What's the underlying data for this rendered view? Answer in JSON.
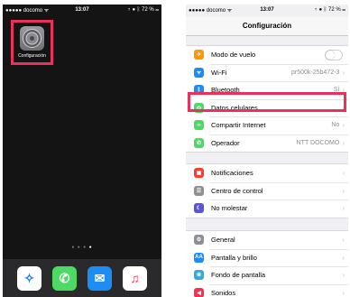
{
  "home": {
    "status": {
      "carrier": "●●●●● docomo ᯤ",
      "time": "13:07",
      "battery": "⇡ ● ᛒ 72 % ▭"
    },
    "app": {
      "label": "Configuración",
      "icon": "gear-icon"
    },
    "dock": [
      {
        "name": "safari",
        "icon": "compass-icon",
        "bg": "#ffffff",
        "fg": "#1a7cf0",
        "glyph": "✧"
      },
      {
        "name": "phone",
        "icon": "phone-icon",
        "bg": "#4cd964",
        "fg": "#ffffff",
        "glyph": "✆"
      },
      {
        "name": "mail",
        "icon": "mail-icon",
        "bg": "#1d8cf3",
        "fg": "#ffffff",
        "glyph": "✉"
      },
      {
        "name": "music",
        "icon": "music-note-icon",
        "bg": "#ffffff",
        "fg": "#fc3c5f",
        "glyph": "♫"
      }
    ]
  },
  "settings": {
    "status": {
      "carrier": "●●●●● docomo ᯤ",
      "time": "13:07",
      "battery": "⇡ ● ᛒ 72 % ▭"
    },
    "title": "Configuración",
    "groups": [
      [
        {
          "label": "Modo de vuelo",
          "icon": "airplane-icon",
          "color": "#ff9500",
          "glyph": "✈",
          "toggle": true
        },
        {
          "label": "Wi-Fi",
          "icon": "wifi-icon",
          "color": "#1c8cf4",
          "glyph": "ᯤ",
          "value": "pr500k-25b472-3"
        },
        {
          "label": "Bluetooth",
          "icon": "bluetooth-icon",
          "color": "#1c8cf4",
          "glyph": "ᛒ",
          "value": "Sí"
        },
        {
          "label": "Datos celulares",
          "icon": "cellular-icon",
          "color": "#4cd964",
          "glyph": "◎",
          "value": ""
        },
        {
          "label": "Compartir Internet",
          "icon": "hotspot-icon",
          "color": "#4cd964",
          "glyph": "∞",
          "value": "No"
        },
        {
          "label": "Operador",
          "icon": "carrier-phone-icon",
          "color": "#4cd964",
          "glyph": "✆",
          "value": "NTT DOCOMO"
        }
      ],
      [
        {
          "label": "Notificaciones",
          "icon": "notifications-icon",
          "color": "#ff3b30",
          "glyph": "▣",
          "value": ""
        },
        {
          "label": "Centro de control",
          "icon": "control-center-icon",
          "color": "#8e8e93",
          "glyph": "☰",
          "value": ""
        },
        {
          "label": "No molestar",
          "icon": "moon-icon",
          "color": "#5856d6",
          "glyph": "☾",
          "value": ""
        }
      ],
      [
        {
          "label": "General",
          "icon": "gear-icon",
          "color": "#8e8e93",
          "glyph": "⚙",
          "value": ""
        },
        {
          "label": "Pantalla y brillo",
          "icon": "display-icon",
          "color": "#1c8cf4",
          "glyph": "AA",
          "value": ""
        },
        {
          "label": "Fondo de pantalla",
          "icon": "wallpaper-icon",
          "color": "#34aadc",
          "glyph": "❀",
          "value": ""
        },
        {
          "label": "Sonidos",
          "icon": "speaker-icon",
          "color": "#ff2d55",
          "glyph": "◀",
          "value": ""
        }
      ]
    ]
  }
}
